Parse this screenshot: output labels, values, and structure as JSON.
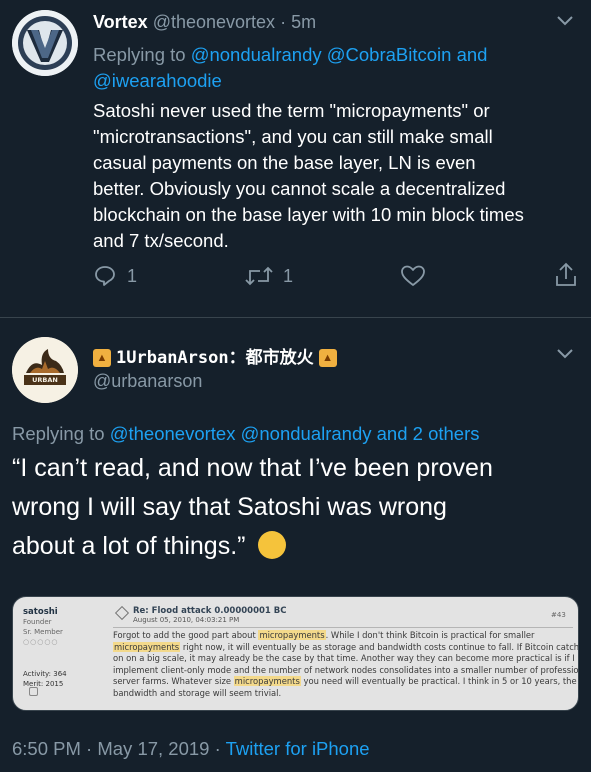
{
  "tweet1": {
    "name": "Vortex",
    "handle": "@theonevortex",
    "separator": "·",
    "time": "5m",
    "replying_prefix": "Replying to",
    "replying_users": [
      "@nondualrandy",
      "@CobraBitcoin"
    ],
    "replying_and": "and",
    "replying_last": "@iwearahoodie",
    "text_lines": [
      "Satoshi never used the term \"micropayments\" or",
      "\"microtransactions\", and you can still make small",
      "casual payments on the base layer, LN is even",
      "better. Obviously you cannot scale a decentralized",
      "blockchain on the base layer with 10 min block times",
      "and 7 tx/second."
    ],
    "reply_count": "1",
    "retweet_count": "1"
  },
  "tweet2": {
    "display_name": "1UrbanArson：都市放火",
    "handle": "@urbanarson",
    "avatar_text": "URBAN ARSON",
    "replying_prefix": "Replying to",
    "replying_users": [
      "@theonevortex",
      "@nondualrandy"
    ],
    "replying_and": "and",
    "replying_others": "2 others",
    "quote_lines": [
      "“I can’t read, and now that I’ve been proven",
      "wrong I will say that Satoshi was wrong",
      "about a lot of things.”"
    ],
    "emoji": "🤪",
    "footer_time": "6:50 PM",
    "footer_sep1": "·",
    "footer_date": "May 17, 2019",
    "footer_sep2": "·",
    "footer_client": "Twitter for iPhone"
  },
  "forum_card": {
    "username": "satoshi",
    "rank1": "Founder",
    "rank2": "Sr. Member",
    "activity": "Activity: 364",
    "merit": "Merit: 2015",
    "title": "Re: Flood attack 0.00000001 BC",
    "date": "August 05, 2010, 04:03:21 PM",
    "post_number": "#43",
    "body_lines": [
      [
        "Forgot to add the good part about ",
        "micropayments",
        ".  While I don't think Bitcoin is practical for smaller"
      ],
      [
        "",
        "micropayments",
        " right now, it will eventually be as storage and bandwidth costs continue to fall.  If Bitcoin catches"
      ],
      [
        "on on a big scale, it may already be the case by that time.  Another way they can become more practical is if I",
        "",
        ""
      ],
      [
        "implement client-only mode and the number of network nodes consolidates into a smaller number of professional",
        "",
        ""
      ],
      [
        "server farms.  Whatever size ",
        "micropayments",
        " you need will eventually be practical.  I think in 5 or 10 years, the"
      ],
      [
        "bandwidth and storage will seem trivial.",
        "",
        ""
      ]
    ]
  },
  "colors": {
    "background": "#15202b",
    "accent": "#1da1f2",
    "muted": "#8899a6",
    "divider": "#38444d"
  },
  "icons": {
    "reply": "reply-icon",
    "retweet": "retweet-icon",
    "like": "heart-icon",
    "share": "share-icon",
    "caret": "chevron-down-icon"
  }
}
